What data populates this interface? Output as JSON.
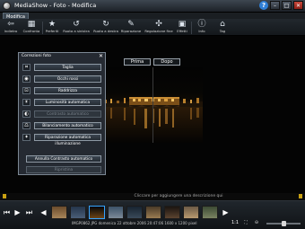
{
  "app": {
    "title": "MediaShow - Foto - Modifica",
    "active_tab": "Modifica"
  },
  "toolbar": [
    {
      "label": "Indietro",
      "icon": "back-icon"
    },
    {
      "label": "Confronta",
      "icon": "compare-icon"
    },
    {
      "label": "Preferiti",
      "icon": "star-icon"
    },
    {
      "label": "Ruota a sinistra",
      "icon": "rotate-left-icon"
    },
    {
      "label": "Ruota a destra",
      "icon": "rotate-right-icon"
    },
    {
      "label": "Riparazione",
      "icon": "repair-icon"
    },
    {
      "label": "Regolazione fine",
      "icon": "fine-tune-icon"
    },
    {
      "label": "Effetti",
      "icon": "effects-icon"
    },
    {
      "label": "Info",
      "icon": "info-icon"
    },
    {
      "label": "Tag",
      "icon": "tag-icon"
    }
  ],
  "compare": {
    "before": "Prima",
    "after": "Dopo"
  },
  "panel": {
    "title": "Correzioni foto",
    "buttons": [
      {
        "label": "Taglia",
        "icon": "crop-icon",
        "enabled": true
      },
      {
        "label": "Occhi rossi",
        "icon": "red-eye-icon",
        "enabled": true
      },
      {
        "label": "Raddrizza",
        "icon": "straighten-icon",
        "enabled": true
      },
      {
        "label": "Luminosità automatica",
        "icon": "brightness-icon",
        "enabled": true
      },
      {
        "label": "Contrasto automatico",
        "icon": "contrast-icon",
        "enabled": false
      },
      {
        "label": "Bilanciamento automatico",
        "icon": "white-balance-icon",
        "enabled": true
      },
      {
        "label": "Riparazione automatica illuminazione",
        "icon": "lighting-icon",
        "enabled": true
      }
    ],
    "undo_label": "Annulla Contrasto automatico",
    "reset_label": "Ripristina"
  },
  "hint": "Cliccare per aggiungere una descrizione qui",
  "status": {
    "filename": "IMGP0862.JPG",
    "date": "domenica 22 ottobre 2006 20:47:06",
    "dimensions": "1600 x 1200 pixel"
  },
  "zoom_label": "1:1",
  "zoom_fraction": 0.5,
  "colors": {
    "accent": "#36a3ff",
    "indicator": "#c8a012"
  }
}
